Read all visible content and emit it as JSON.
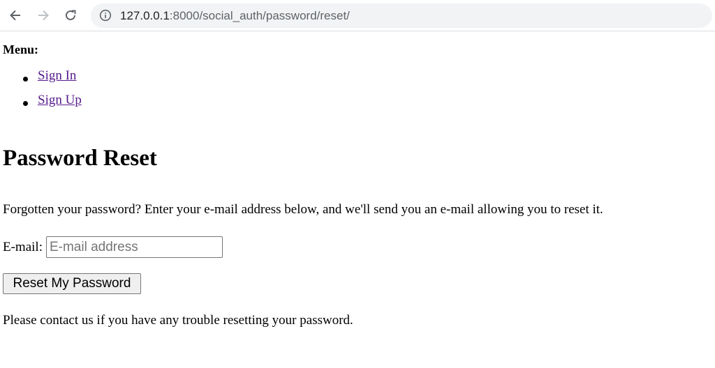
{
  "browser": {
    "url_host": "127.0.0.1",
    "url_path": ":8000/social_auth/password/reset/"
  },
  "menu": {
    "label": "Menu:",
    "items": [
      {
        "label": "Sign In"
      },
      {
        "label": "Sign Up"
      }
    ]
  },
  "page": {
    "title": "Password Reset",
    "intro": "Forgotten your password? Enter your e-mail address below, and we'll send you an e-mail allowing you to reset it.",
    "email_label": "E-mail:",
    "email_placeholder": "E-mail address",
    "email_value": "",
    "submit_label": "Reset My Password",
    "contact_text": "Please contact us if you have any trouble resetting your password."
  }
}
